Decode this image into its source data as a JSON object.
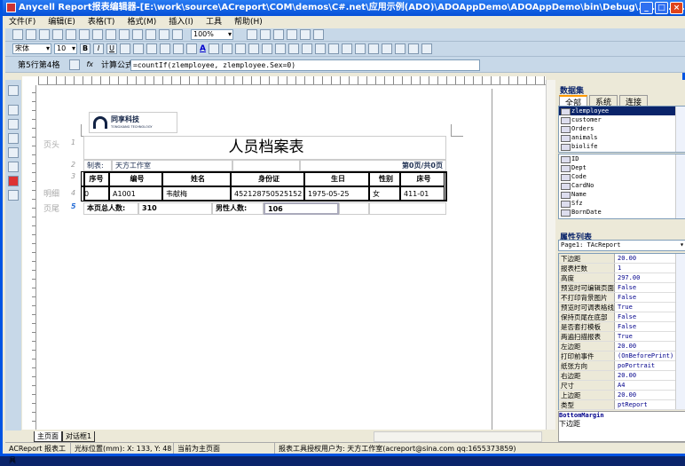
{
  "window": {
    "title": "Anycell Report报表编辑器-[E:\\work\\source\\ACreport\\COM\\demos\\C#.net\\应用示例(ADO)\\ADOAppDemo\\ADOAppDemo\\bin\\Debug\\..\\..\\..\\..\\..\\Reports\\list.apt]",
    "min": "_",
    "max": "□",
    "close": "×"
  },
  "menu": [
    "文件(F)",
    "编辑(E)",
    "表格(T)",
    "格式(M)",
    "插入(I)",
    "工具",
    "帮助(H)"
  ],
  "toolbar": {
    "zoom": "100%",
    "font": "宋体",
    "size": "10",
    "bold": "B",
    "italic": "I",
    "underline": "U",
    "color_a": "A"
  },
  "formula_bar": {
    "cell": "第5行第4格",
    "fx": "fx",
    "label": "计算公式=",
    "value": "=countIf(zlemployee, zlemployee.Sex=0)"
  },
  "logo": {
    "cn": "同享科技",
    "en": "TONGXIANG TECHNOLOGY"
  },
  "report": {
    "row_labels": {
      "header": "页头",
      "detail": "明细",
      "footer": "页尾"
    },
    "row_numbers": [
      "1",
      "2",
      "3",
      "4",
      "5"
    ],
    "title": "人员档案表",
    "maker_label": "制表:",
    "maker": "天方工作室",
    "page_info": "第0页/共0页",
    "columns": [
      "序号",
      "编号",
      "姓名",
      "身份证",
      "生日",
      "性别",
      "床号"
    ],
    "row": [
      "0",
      "A1001",
      "韦献梅",
      "452128750525152",
      "1975-05-25",
      "女",
      "411-01"
    ],
    "footer": {
      "total_label": "本页总人数:",
      "total": "310",
      "male_label": "男性人数:",
      "male": "106"
    }
  },
  "dataset": {
    "title": "数据集",
    "tabs": [
      "全部",
      "系统",
      "连接"
    ],
    "tables": [
      "zlemployee",
      "customer",
      "Orders",
      "animals",
      "biolife"
    ],
    "fields": [
      "ID",
      "Dept",
      "Code",
      "CardNo",
      "Name",
      "Sfz",
      "BornDate"
    ]
  },
  "props": {
    "title": "属性列表",
    "object": "Page1: TAcReport",
    "rows": [
      [
        "下边距",
        "20.00"
      ],
      [
        "报表栏数",
        "1"
      ],
      [
        "高度",
        "297.00"
      ],
      [
        "预览时可编辑页面",
        "False"
      ],
      [
        "不打印背景图片",
        "False"
      ],
      [
        "预览时可调表格线",
        "True"
      ],
      [
        "保持页尾在底部",
        "False"
      ],
      [
        "是否套打模板",
        "False"
      ],
      [
        "两遍扫描报表",
        "True"
      ],
      [
        "左边距",
        "20.00"
      ],
      [
        "打印前事件",
        "(OnBeforePrint)"
      ],
      [
        "纸张方向",
        "poPortrait"
      ],
      [
        "右边距",
        "20.00"
      ],
      [
        "尺寸",
        "A4"
      ],
      [
        "上边距",
        "20.00"
      ],
      [
        "类型",
        "ptReport"
      ]
    ],
    "desc_name": "BottomMargin",
    "desc": "下边距"
  },
  "tabs": [
    "主页面",
    "对话框1"
  ],
  "status": {
    "app": "ACReport 报表工具",
    "cursor": "光标位置(mm): X: 133, Y: 48",
    "page": "当前为主页面",
    "license": "报表工具授权用户为: 天方工作室(acreport@sina.com qq:1655373859)"
  }
}
